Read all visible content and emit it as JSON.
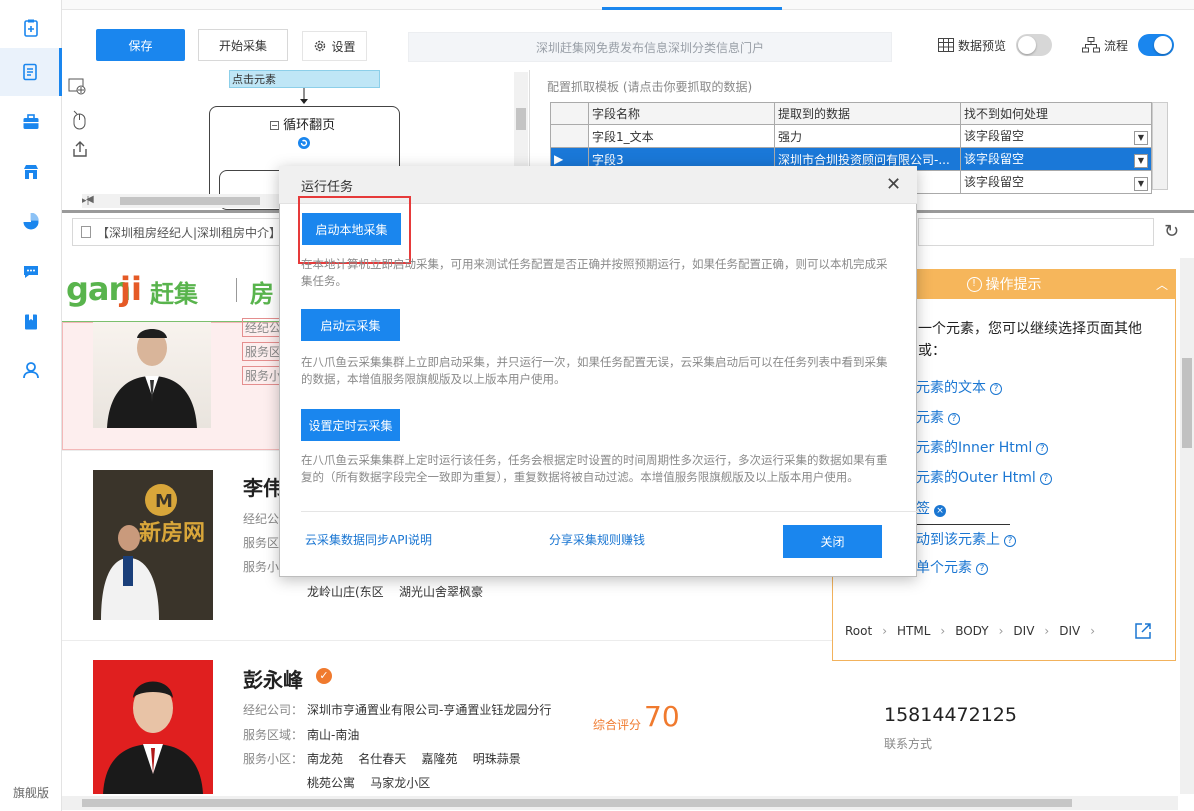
{
  "sidebar": {
    "footer_label": "旗舰版",
    "items": [
      {
        "icon": "clipboard-add-icon"
      },
      {
        "icon": "document-list-icon"
      },
      {
        "icon": "briefcase-icon"
      },
      {
        "icon": "store-icon"
      },
      {
        "icon": "pie-chart-icon"
      },
      {
        "icon": "chat-bubble-icon"
      },
      {
        "icon": "book-icon"
      },
      {
        "icon": "user-icon"
      }
    ]
  },
  "toolbar": {
    "save_label": "保存",
    "start_label": "开始采集",
    "settings_label": "设置",
    "url_text": "深圳赶集网免费发布信息深圳分类信息门户",
    "preview_label": "数据预览",
    "flow_label": "流程",
    "preview_on": false,
    "flow_on": true
  },
  "flow": {
    "step_label": "点击元素",
    "loop_label": "循环翻页"
  },
  "grid": {
    "title": "配置抓取模板 (请点击你要抓取的数据)",
    "headers": [
      "字段名称",
      "提取到的数据",
      "找不到如何处理"
    ],
    "rows": [
      {
        "name": "字段1_文本",
        "value": "强力",
        "handle": "该字段留空"
      },
      {
        "name": "字段3",
        "value": "深圳市合圳投资顾问有限公司-...",
        "handle": "该字段留空"
      },
      {
        "name": "",
        "value": "",
        "handle": "该字段留空"
      }
    ]
  },
  "browser": {
    "url_text": "【深圳租房经纪人|深圳租房中介】"
  },
  "webpage": {
    "logo_gan": "gan",
    "logo_ji": "ji",
    "logo_cn": "赶集",
    "logo_section": "房",
    "agents": [
      {
        "name": "",
        "labels": [
          "经纪公",
          "服务区",
          "服务小"
        ]
      },
      {
        "name": "李伟",
        "labels": [
          "经纪公",
          "服务区",
          "服务小"
        ],
        "communities": "龙岭山庄(东区    湖光山舍翠枫豪"
      },
      {
        "name": "彭永峰",
        "company_label": "经纪公司：",
        "company": "深圳市亨通置业有限公司-亨通置业钰龙园分行",
        "area_label": "服务区域：",
        "area": "南山-南油",
        "community_label": "服务小区：",
        "communities_line1": "南龙苑    名仕春天    嘉隆苑    明珠蒜景",
        "communities_line2": "桃苑公寓    马家龙小区",
        "score_label": "综合评分",
        "score": "70",
        "phone": "15814472125",
        "phone_label": "联系方式"
      }
    ]
  },
  "tips": {
    "header": "操作提示",
    "intro_line1": "一个元素，您可以继续选择页面其他",
    "intro_line2": "或：",
    "options": [
      "元素的文本",
      "元素",
      "元素的Inner Html",
      "元素的Outer Html",
      "签",
      "动到该元素上",
      "单个元素"
    ],
    "breadcrumbs": [
      "Root",
      "HTML",
      "BODY",
      "DIV",
      "DIV"
    ]
  },
  "dialog": {
    "title": "运行任务",
    "local_button": "启动本地采集",
    "local_desc": "在本地计算机立即启动采集，可用来测试任务配置是否正确并按照预期运行，如果任务配置正确，则可以本机完成采集任务。",
    "cloud_button": "启动云采集",
    "cloud_desc": "在八爪鱼云采集集群上立即启动采集，并只运行一次，如果任务配置无误，云采集启动后可以在任务列表中看到采集的数据，本增值服务限旗舰版及以上版本用户使用。",
    "scheduled_button": "设置定时云采集",
    "scheduled_desc": "在八爪鱼云采集集群上定时运行该任务，任务会根据定时设置的时间周期性多次运行，多次运行采集的数据如果有重复的（所有数据字段完全一致即为重复），重复数据将被自动过滤。本增值服务限旗舰版及以上版本用户使用。",
    "api_link": "云采集数据同步API说明",
    "share_link": "分享采集规则赚钱",
    "close_button": "关闭"
  }
}
